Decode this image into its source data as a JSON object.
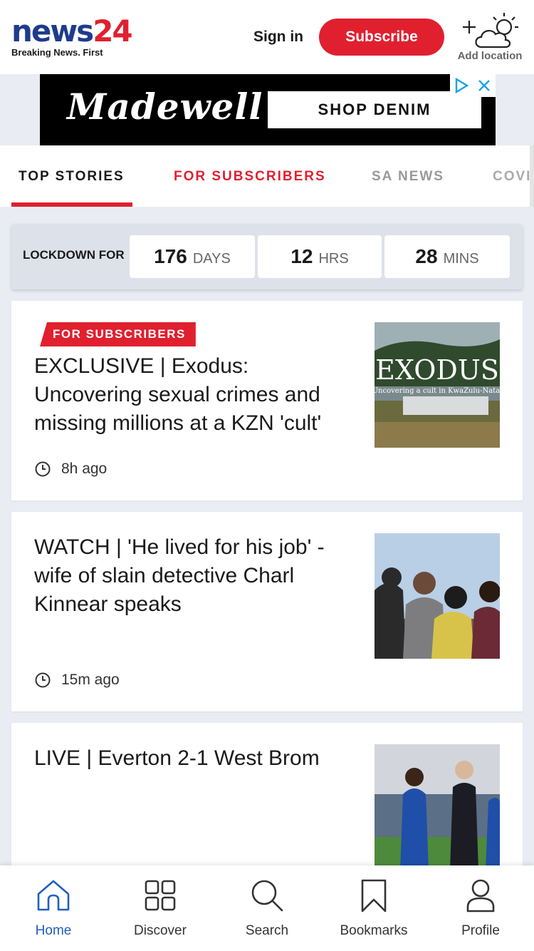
{
  "header": {
    "logo_text": "news",
    "logo_number": "24",
    "tagline": "Breaking News. First",
    "signin_label": "Sign in",
    "subscribe_label": "Subscribe",
    "location_label": "Add location",
    "location_icon": "weather-cloud-sun-icon"
  },
  "ad": {
    "brand": "Madewell",
    "cta": "SHOP DENIM",
    "adchoices_icon": "adchoices-icon",
    "close_icon": "close-icon"
  },
  "tabs": [
    {
      "label": "TOP STORIES",
      "active": true
    },
    {
      "label": "FOR SUBSCRIBERS",
      "active": false
    },
    {
      "label": "SA NEWS",
      "active": false
    },
    {
      "label": "COVI",
      "active": false
    }
  ],
  "lockdown": {
    "label": "LOCKDOWN FOR",
    "days": "176",
    "days_unit": "DAYS",
    "hours": "12",
    "hours_unit": "HRS",
    "mins": "28",
    "mins_unit": "MINS"
  },
  "stories": [
    {
      "badge": "FOR SUBSCRIBERS",
      "headline": "EXCLUSIVE | Exodus: Uncovering sexual crimes and missing millions at a KZN 'cult'",
      "time": "8h ago",
      "image_title": "EXODUS",
      "image_subtitle": "Uncovering a cult in KwaZulu-Natal"
    },
    {
      "badge": "",
      "headline": "WATCH | 'He lived for his job' - wife of slain detective Charl Kinnear speaks",
      "time": "15m ago"
    },
    {
      "badge": "",
      "headline": "LIVE | Everton 2-1 West Brom",
      "time": ""
    }
  ],
  "nav": [
    {
      "label": "Home",
      "icon": "home-icon",
      "active": true
    },
    {
      "label": "Discover",
      "icon": "grid-icon",
      "active": false
    },
    {
      "label": "Search",
      "icon": "search-icon",
      "active": false
    },
    {
      "label": "Bookmarks",
      "icon": "bookmark-icon",
      "active": false
    },
    {
      "label": "Profile",
      "icon": "profile-icon",
      "active": false
    }
  ],
  "colors": {
    "brand_red": "#e0202f",
    "brand_blue": "#1f3b8c",
    "active_nav": "#1f5fbf"
  }
}
